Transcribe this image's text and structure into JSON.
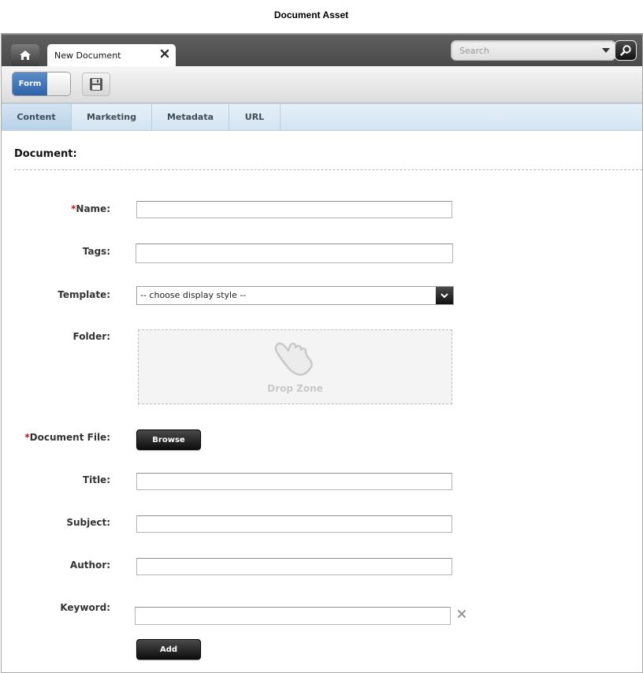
{
  "page": {
    "title": "Document Asset"
  },
  "topbar": {
    "home_icon": "home-icon",
    "tab_label": "New Document",
    "tab_close_icon": "close-icon",
    "search_placeholder": "Search",
    "search_icon": "search-icon"
  },
  "toolbar": {
    "form_toggle_label": "Form",
    "save_icon": "floppy-disk-icon"
  },
  "tabs": [
    {
      "label": "Content",
      "active": true
    },
    {
      "label": "Marketing",
      "active": false
    },
    {
      "label": "Metadata",
      "active": false
    },
    {
      "label": "URL",
      "active": false
    }
  ],
  "form": {
    "section_title": "Document:",
    "required_marker": "*",
    "name_label": "Name:",
    "name_value": "",
    "tags_label": "Tags:",
    "tags_value": "",
    "template_label": "Template:",
    "template_value": "-- choose display style --",
    "folder_label": "Folder:",
    "dropzone_label": "Drop Zone",
    "document_file_label": "Document File:",
    "browse_label": "Browse",
    "title_label": "Title:",
    "title_value": "",
    "subject_label": "Subject:",
    "subject_value": "",
    "author_label": "Author:",
    "author_value": "",
    "keyword_label": "Keyword:",
    "keyword_value": "",
    "add_label": "Add"
  },
  "colors": {
    "accent_blue": "#2f63a8",
    "required_red": "#c0141b",
    "tab_bar": "#d3e4f1"
  }
}
